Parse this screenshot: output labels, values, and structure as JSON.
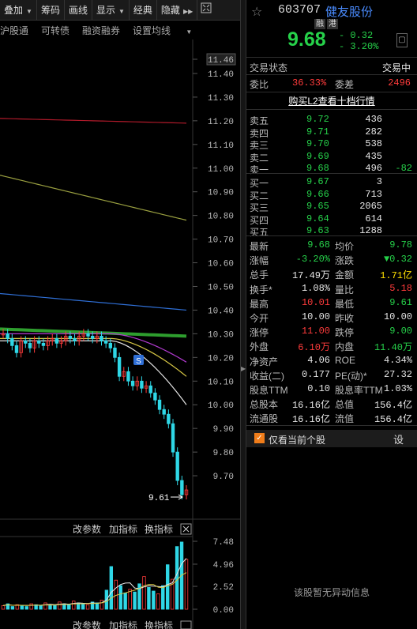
{
  "toolbar": {
    "items": [
      "叠加",
      "筹码",
      "画线",
      "显示",
      "经典",
      "隐藏"
    ],
    "expand_icon": "expand-icon"
  },
  "subbar": [
    "沪股通",
    "可转债",
    "融资融券",
    "设置均线"
  ],
  "panel": {
    "indicator_buttons": [
      "改参数",
      "加指标",
      "换指标"
    ],
    "indicator_buttons_bottom": [
      "改参数",
      "加指标",
      "换指标"
    ],
    "close_icon": "close-icon"
  },
  "chart_data": {
    "type": "line",
    "title": "",
    "price_axis_labels": [
      "11.46",
      "11.40",
      "11.30",
      "11.20",
      "11.10",
      "11.00",
      "10.90",
      "10.80",
      "10.70",
      "10.60",
      "10.50",
      "10.40",
      "10.30",
      "10.20",
      "10.10",
      "10.00",
      "9.90",
      "9.80",
      "9.70"
    ],
    "ylim": [
      9.58,
      11.46
    ],
    "last_price_annotation": "9.61",
    "marker_label": "S",
    "price_series": [
      10.3,
      10.28,
      10.25,
      10.22,
      10.27,
      10.26,
      10.24,
      10.27,
      10.26,
      10.25,
      10.27,
      10.28,
      10.26,
      10.27,
      10.29,
      10.28,
      10.27,
      10.29,
      10.3,
      10.29,
      10.28,
      10.29,
      10.27,
      10.26,
      10.24,
      10.2,
      10.12,
      10.14,
      10.1,
      10.08,
      10.1,
      10.07,
      10.08,
      10.05,
      10.02,
      9.98,
      9.96,
      9.92,
      9.8,
      9.68,
      9.62,
      9.64
    ],
    "moving_averages": [
      {
        "color": "#b01a2a",
        "start": 11.21,
        "end": 11.19
      },
      {
        "color": "#9aa040",
        "start": 10.97,
        "end": 10.78
      },
      {
        "color": "#2f6fd6",
        "start": 10.47,
        "end": 10.4
      },
      {
        "color": "#2e9e2e",
        "start": 10.32,
        "end": 10.29
      },
      {
        "color": "#b23ad0",
        "start": 10.3,
        "end": 10.18
      },
      {
        "color": "#d8c845",
        "start": 10.28,
        "end": 10.12
      },
      {
        "color": "#e6e6e6",
        "start": 10.27,
        "end": 10.0
      }
    ],
    "volume_axis_labels": [
      "7.48",
      "4.96",
      "2.52",
      "0.00"
    ],
    "volume_ylim": [
      0,
      7.48
    ],
    "volume": [
      0.4,
      0.6,
      0.3,
      0.5,
      0.4,
      0.3,
      0.6,
      0.5,
      0.4,
      0.7,
      0.5,
      0.4,
      0.8,
      0.6,
      0.5,
      0.9,
      0.7,
      0.6,
      0.5,
      0.8,
      0.7,
      1.0,
      2.1,
      4.7,
      3.2,
      2.6,
      1.8,
      2.2,
      1.9,
      2.8,
      3.6,
      2.4,
      2.0,
      1.7,
      2.6,
      4.9,
      3.3,
      6.9,
      7.4,
      5.5
    ]
  },
  "quote": {
    "code": "603707",
    "name": "健友股份",
    "tags": [
      "融",
      "港"
    ],
    "price": "9.68",
    "change": "- 0.32",
    "change_pct": "- 3.20%",
    "status_label": "交易状态",
    "status_value": "交易中",
    "wb_label": "委比",
    "wb_value": "36.33%",
    "wc_label": "委差",
    "wc_value": "2496",
    "l2_link": "购买L2查看十档行情"
  },
  "order_book": {
    "asks": [
      {
        "label": "卖五",
        "price": "9.72",
        "vol": "436",
        "delta": ""
      },
      {
        "label": "卖四",
        "price": "9.71",
        "vol": "282",
        "delta": ""
      },
      {
        "label": "卖三",
        "price": "9.70",
        "vol": "538",
        "delta": ""
      },
      {
        "label": "卖二",
        "price": "9.69",
        "vol": "435",
        "delta": ""
      },
      {
        "label": "卖一",
        "price": "9.68",
        "vol": "496",
        "delta": "-82"
      }
    ],
    "bids": [
      {
        "label": "买一",
        "price": "9.67",
        "vol": "3"
      },
      {
        "label": "买二",
        "price": "9.66",
        "vol": "713"
      },
      {
        "label": "买三",
        "price": "9.65",
        "vol": "2065"
      },
      {
        "label": "买四",
        "price": "9.64",
        "vol": "614"
      },
      {
        "label": "买五",
        "price": "9.63",
        "vol": "1288"
      }
    ]
  },
  "stats": [
    {
      "l1": "最新",
      "v1": "9.68",
      "c1": "green",
      "l2": "均价",
      "v2": "9.78",
      "c2": "green"
    },
    {
      "l1": "涨幅",
      "v1": "-3.20%",
      "c1": "green",
      "l2": "涨跌",
      "v2": "▼0.32",
      "c2": "green"
    },
    {
      "l1": "总手",
      "v1": "17.49万",
      "c1": "white",
      "l2": "金额",
      "v2": "1.71亿",
      "c2": "yellow"
    },
    {
      "l1": "换手*",
      "v1": "1.08%",
      "c1": "white",
      "l2": "量比",
      "v2": "5.18",
      "c2": "red"
    },
    {
      "l1": "最高",
      "v1": "10.01",
      "c1": "red",
      "l2": "最低",
      "v2": "9.61",
      "c2": "green"
    },
    {
      "l1": "今开",
      "v1": "10.00",
      "c1": "white",
      "l2": "昨收",
      "v2": "10.00",
      "c2": "white"
    },
    {
      "l1": "涨停",
      "v1": "11.00",
      "c1": "red",
      "l2": "跌停",
      "v2": "9.00",
      "c2": "green"
    },
    {
      "l1": "外盘",
      "v1": "6.10万",
      "c1": "red",
      "l2": "内盘",
      "v2": "11.40万",
      "c2": "green"
    },
    {
      "l1": "净资产",
      "v1": "4.06",
      "c1": "white",
      "l2": "ROE",
      "v2": "4.34%",
      "c2": "white"
    },
    {
      "l1": "收益(二)",
      "v1": "0.177",
      "c1": "white",
      "l2": "PE(动)*",
      "v2": "27.32",
      "c2": "white"
    },
    {
      "l1": "股息TTM",
      "v1": "0.10",
      "c1": "white",
      "l2": "股息率TTM",
      "v2": "1.03%",
      "c2": "white"
    },
    {
      "l1": "总股本",
      "v1": "16.16亿",
      "c1": "white",
      "l2": "总值",
      "v2": "156.4亿",
      "c2": "white"
    },
    {
      "l1": "流通股",
      "v1": "16.16亿",
      "c1": "white",
      "l2": "流值",
      "v2": "156.4亿",
      "c2": "white"
    }
  ],
  "filter": {
    "label": "仅看当前个股",
    "settings": "设",
    "checked": true
  },
  "empty_message": "该股暂无异动信息"
}
